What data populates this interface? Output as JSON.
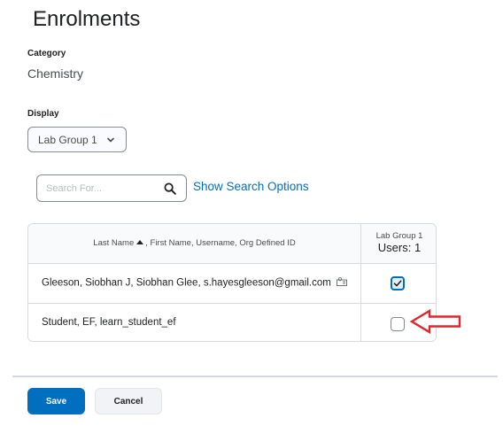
{
  "page": {
    "title": "Enrolments"
  },
  "category": {
    "label": "Category",
    "value": "Chemistry"
  },
  "display": {
    "label": "Display",
    "selected": "Lab Group 1"
  },
  "search": {
    "placeholder": "Search For...",
    "options_link": "Show Search Options"
  },
  "grid": {
    "header_name_part1": "Last Name",
    "header_name_part2": ", First Name, Username, Org Defined ID",
    "group_title": "Lab Group 1",
    "group_users": "Users: 1",
    "rows": [
      {
        "name": "Gleeson, Siobhan J, Siobhan Glee, s.hayesgleeson@gmail.com",
        "enrolled": true
      },
      {
        "name": "Student, EF, learn_student_ef",
        "enrolled": false
      }
    ]
  },
  "buttons": {
    "save": "Save",
    "cancel": "Cancel"
  },
  "colors": {
    "accent": "#006fbf",
    "annotation_arrow": "#e0262b"
  }
}
